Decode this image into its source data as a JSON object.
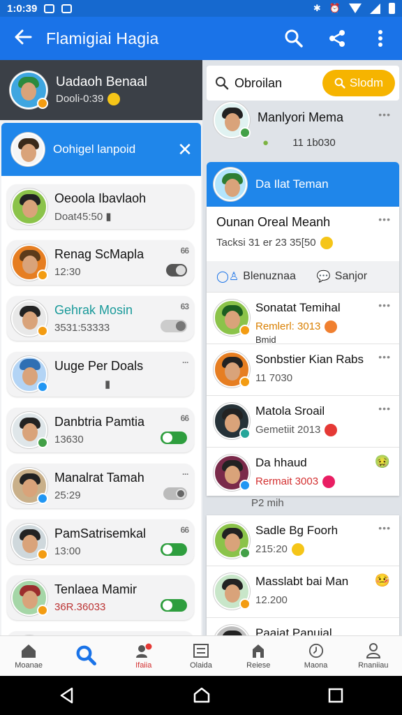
{
  "status": {
    "time": "1:0:39"
  },
  "appbar": {
    "title": "Flamigiai Hagia"
  },
  "profile": {
    "name": "Uadaoh Benaal",
    "sub": "Dooli-0:39"
  },
  "chat_header": {
    "name": "Oohigel lanpoid"
  },
  "left_list": [
    {
      "name": "Oeoola Ibavlaoh",
      "sub": "Doat45:50",
      "mark": "",
      "pill": "",
      "color": "#2d7d46"
    },
    {
      "name": "Renag ScMapla",
      "sub": "12:30",
      "mark": "66",
      "pill": "dark",
      "color": "#c0392b"
    },
    {
      "name": "Gehrak Mosin",
      "sub": "3531:53333",
      "mark": "63",
      "pill": "grey",
      "color": "#1c2c3a",
      "teal": true
    },
    {
      "name": "Uuge Per Doals",
      "sub": "",
      "mark": "···",
      "pill": "",
      "color": "#2f6fb3"
    },
    {
      "name": "Danbtria Pamtia",
      "sub": "13630",
      "mark": "66",
      "pill": "green",
      "color": "#3a7d3a"
    },
    {
      "name": "Manalrat Tamah",
      "sub": "25:29",
      "mark": "···",
      "pill": "greyring",
      "color": "#6b4a2b"
    },
    {
      "name": "PamSatrisemkal",
      "sub": "13:00",
      "mark": "66",
      "pill": "green",
      "color": "#2b5d8a"
    },
    {
      "name": "Tenlaea Mamir",
      "sub": "36R.36033",
      "mark": "",
      "pill": "green",
      "color": "#9b2d2d"
    }
  ],
  "search": {
    "placeholder": "Obroilan",
    "button": "Slodm"
  },
  "right_header": {
    "name": "Manlyori Mema",
    "meta": "11 1b030"
  },
  "blue_card": {
    "name": "Da Ilat Teman"
  },
  "post": {
    "title": "Ounan Oreal Meanh",
    "sub": "Tacksi 31 er 23 35[50"
  },
  "post_actions": {
    "left": "Blenuznaa",
    "right": "Sanjor"
  },
  "right_list": [
    {
      "name": "Sonatat Temihal",
      "sub": "Remlerl: 3013",
      "extra": "Bmid",
      "color": "#3b8b3b",
      "subcolor": "#d97f00"
    },
    {
      "name": "Sonbstier Kian Rabs",
      "sub": "11 7030",
      "extra": "",
      "color": "#c85a1e",
      "subcolor": "#555"
    },
    {
      "name": "Matola Sroail",
      "sub": "Gemetiit 2013",
      "extra": "",
      "color": "#2a2a2a",
      "subcolor": "#555"
    },
    {
      "name": "Da hhaud",
      "sub": "Rermait 3003",
      "extra": "",
      "color": "#7a2a4a",
      "subcolor": "#d32f2f"
    }
  ],
  "divider": "P2 mih",
  "right_list2": [
    {
      "name": "Sadle Bg Foorh",
      "sub": "215:20",
      "color": "#3b8b3b"
    },
    {
      "name": "Masslabt bai Man",
      "sub": "12.200",
      "color": "#2a4a2a"
    },
    {
      "name": "Paaiat Panuial",
      "sub": "",
      "color": "#555"
    }
  ],
  "nav": [
    {
      "label": "Moanae",
      "icon": "home-icon"
    },
    {
      "label": "",
      "icon": "search-icon"
    },
    {
      "label": "Ifaiia",
      "icon": "friends-icon"
    },
    {
      "label": "Olaida",
      "icon": "list-icon"
    },
    {
      "label": "Reiese",
      "icon": "store-icon"
    },
    {
      "label": "Maona",
      "icon": "clock-icon"
    },
    {
      "label": "Rnaniiau",
      "icon": "profile-icon"
    }
  ],
  "colors": {
    "primary": "#1a73e8",
    "accent": "#f6b400",
    "header_dark": "#3b4047"
  }
}
